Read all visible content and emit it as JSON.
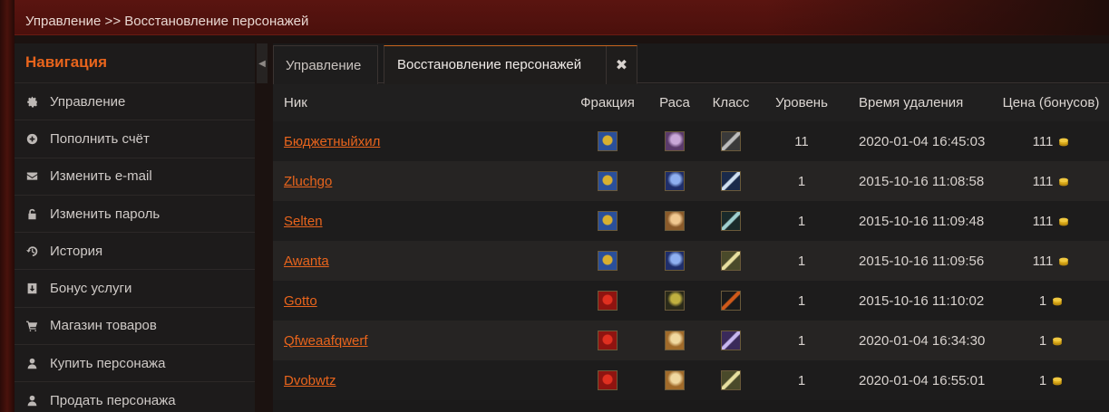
{
  "breadcrumb": "Управление >> Восстановление персонажей",
  "sidebar": {
    "title": "Навигация",
    "items": [
      {
        "label": "Управление",
        "icon": "gear-icon"
      },
      {
        "label": "Пополнить счёт",
        "icon": "plus-circle-icon"
      },
      {
        "label": "Изменить e-mail",
        "icon": "envelope-icon"
      },
      {
        "label": "Изменить пароль",
        "icon": "unlock-icon"
      },
      {
        "label": "История",
        "icon": "history-icon"
      },
      {
        "label": "Бонус услуги",
        "icon": "download-icon"
      },
      {
        "label": "Магазин товаров",
        "icon": "cart-icon"
      },
      {
        "label": "Купить персонажа",
        "icon": "user-icon"
      },
      {
        "label": "Продать персонажа",
        "icon": "user-icon"
      }
    ]
  },
  "tabs": [
    {
      "label": "Управление"
    },
    {
      "label": "Восстановление персонажей",
      "close": "✖"
    }
  ],
  "table": {
    "headers": {
      "nick": "Ник",
      "faction": "Фракция",
      "race": "Раса",
      "class": "Класс",
      "level": "Уровень",
      "deleted": "Время удаления",
      "price": "Цена (бонусов)"
    },
    "rows": [
      {
        "nick": "Бюджетныйхил",
        "faction": "alliance",
        "race": "night-elf-female",
        "class": "warrior",
        "level": "11",
        "deleted": "2020-01-04 16:45:03",
        "price": "111"
      },
      {
        "nick": "Zluchgo",
        "faction": "alliance",
        "race": "draenei-male",
        "class": "rogue",
        "level": "1",
        "deleted": "2015-10-16 11:08:58",
        "price": "111"
      },
      {
        "nick": "Selten",
        "faction": "alliance",
        "race": "human-female",
        "class": "hunter",
        "level": "1",
        "deleted": "2015-10-16 11:09:48",
        "price": "111"
      },
      {
        "nick": "Awanta",
        "faction": "alliance",
        "race": "draenei-male",
        "class": "paladin",
        "level": "1",
        "deleted": "2015-10-16 11:09:56",
        "price": "111"
      },
      {
        "nick": "Gotto",
        "faction": "horde",
        "race": "undead-male",
        "class": "death-knight",
        "level": "1",
        "deleted": "2015-10-16 11:10:02",
        "price": "1"
      },
      {
        "nick": "Qfweaafqwerf",
        "faction": "horde",
        "race": "blood-elf-female",
        "class": "mage",
        "level": "1",
        "deleted": "2020-01-04 16:34:30",
        "price": "1"
      },
      {
        "nick": "Dvobwtz",
        "faction": "horde",
        "race": "blood-elf-female",
        "class": "paladin",
        "level": "1",
        "deleted": "2020-01-04 16:55:01",
        "price": "1"
      }
    ]
  },
  "colors": {
    "accent": "#e8641c",
    "alliance": "#2a4f9a",
    "horde": "#8f1410"
  }
}
